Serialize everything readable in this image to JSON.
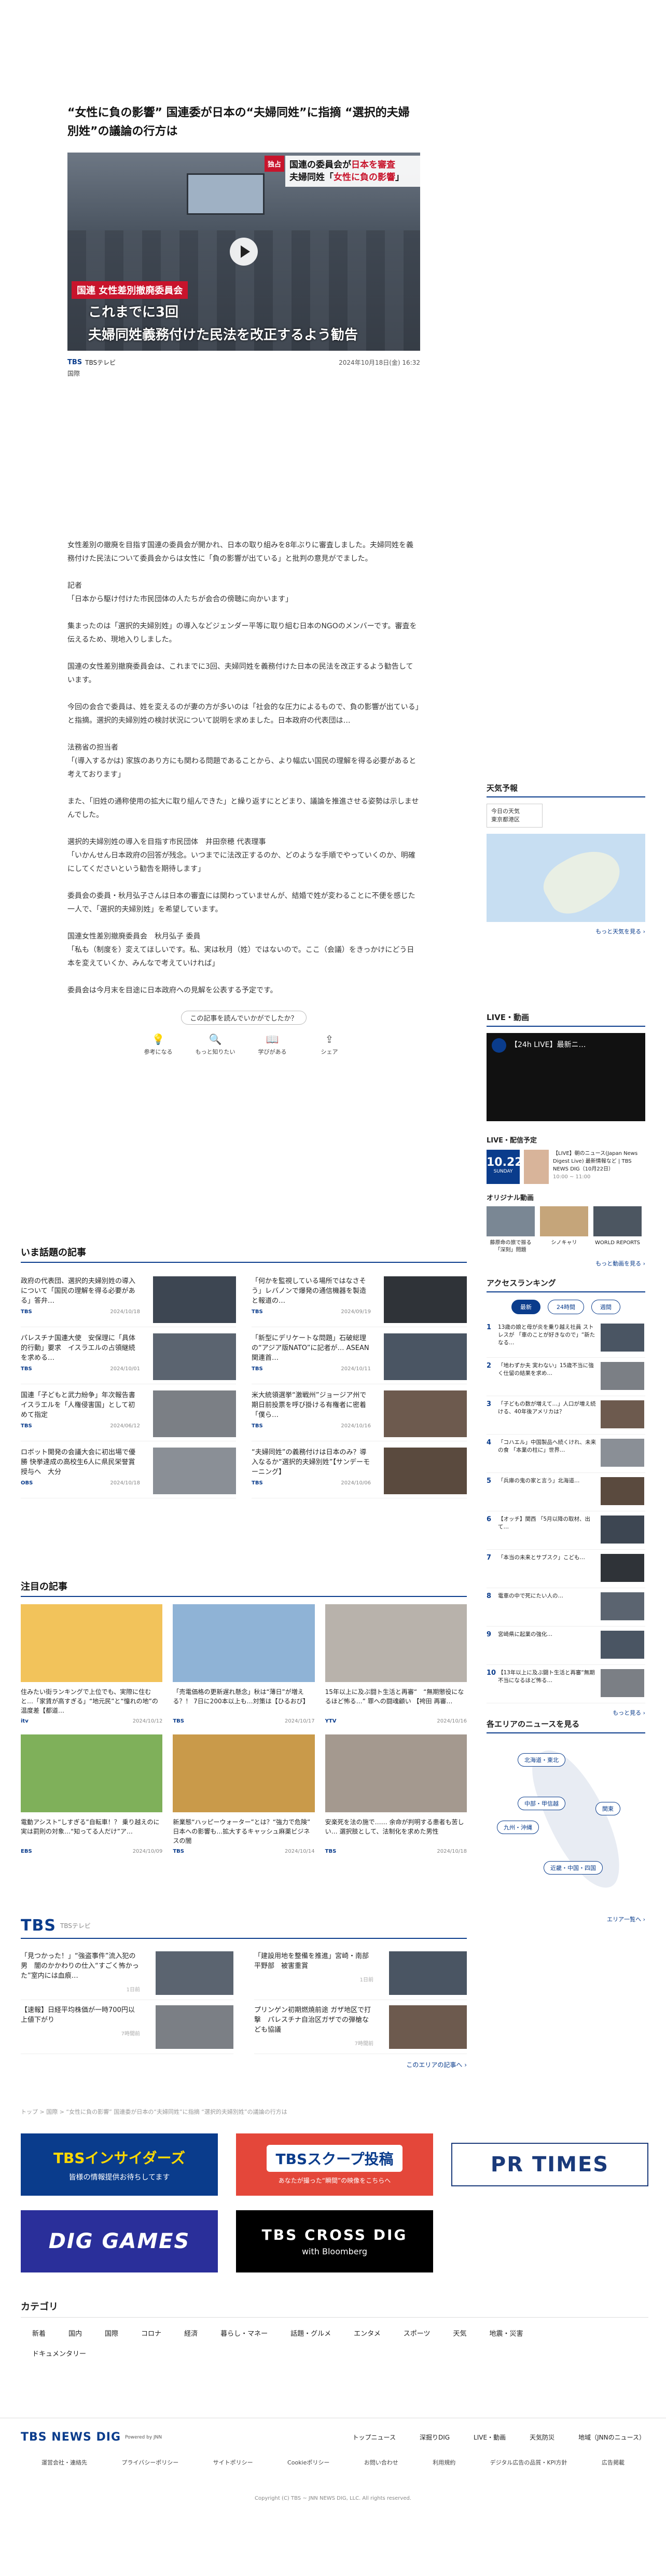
{
  "article": {
    "title": "“女性に負の影響” 国連委が日本の“夫婦同姓”に指摘 “選択的夫婦別姓”の議論の行方は",
    "video_caption": {
      "tag": "独占",
      "top_line1": "国連の委員会が",
      "top_highlight1": "日本を審査",
      "top_line2": "夫婦同姓「",
      "top_highlight2": "女性に負の影響",
      "top_line2_end": "」",
      "committee": "国連 女性差別撤廃委員会",
      "main1": "これまでに3回",
      "main2": "夫婦同姓義務付けた民法を改正するよう勧告"
    },
    "source": "TBSテレビ",
    "date": "2024年10月18日(金) 16:32",
    "category": "国際",
    "paragraphs": [
      "女性差別の撤廃を目指す国連の委員会が開かれ、日本の取り組みを8年ぶりに審査しました。夫婦同姓を義務付けた民法について委員会からは女性に「負の影響が出ている」と批判の意見がでました。",
      "記者\n「日本から駆け付けた市民団体の人たちが会合の傍聴に向かいます」",
      "集まったのは「選択的夫婦別姓」の導入などジェンダー平等に取り組む日本のNGOのメンバーです。審査を伝えるため、現地入りしました。",
      "国連の女性差別撤廃委員会は、これまでに3回、夫婦同姓を義務付けた日本の民法を改正するよう勧告しています。",
      "今回の会合で委員は、姓を変えるのが妻の方が多いのは「社会的な圧力によるもので、負の影響が出ている」と指摘。選択的夫婦別姓の検討状況について説明を求めました。日本政府の代表団は…",
      "法務省の担当者\n「(導入するかは) 家族のあり方にも関わる問題であることから、より幅広い国民の理解を得る必要があると考えております」",
      "また、「旧姓の通称使用の拡大に取り組んできた」と繰り返すにとどまり、議論を推進させる姿勢は示しませんでした。",
      "選択的夫婦別姓の導入を目指す市民団体　井田奈穂 代表理事\n「いかんせん日本政府の回答が残念。いつまでに法改正するのか、どのような手順でやっていくのか、明確にしてくださいという勧告を期待します」",
      "委員会の委員・秋月弘子さんは日本の審査には関わっていませんが、結婚で姓が変わることに不便を感じた一人で、「選択的夫婦別姓」を希望しています。",
      "国連女性差別撤廃委員会　秋月弘子 委員\n「私も（制度を）変えてほしいです。私、実は秋月（姓）ではないので。ここ（会議）をきっかけにどう日本を変えていくか、みんなで考えていければ」",
      "委員会は今月末を目途に日本政府への見解を公表する予定です。"
    ]
  },
  "reactions": {
    "question": "この記事を読んでいかがでしたか？",
    "items": [
      {
        "icon": "lightbulb-icon",
        "glyph": "💡",
        "label": "参考になる"
      },
      {
        "icon": "magnifier-icon",
        "glyph": "🔍",
        "label": "もっと知りたい"
      },
      {
        "icon": "book-icon",
        "glyph": "📖",
        "label": "学びがある"
      },
      {
        "icon": "share-icon",
        "glyph": "⇪",
        "label": "シェア"
      }
    ]
  },
  "popular": {
    "title": "いま話題の記事",
    "items": [
      {
        "title": "政府の代表団、選択的夫婦別姓の導入について「国民の理解を得る必要がある」答弁…",
        "source": "TBS",
        "date": "2024/10/18"
      },
      {
        "title": "「何かを監視している場所ではなさそう」レバノンで爆発の通信機器を製造と報道の…",
        "source": "TBS",
        "date": "2024/09/19"
      },
      {
        "title": "パレスチナ国連大使　安保理に「具体的行動」要求　イスラエルの占領継続を求める…",
        "source": "TBS",
        "date": "2024/10/01"
      },
      {
        "title": "「新型にデリケートな問題」石破総理の“アジア版NATO”に記者が… ASEAN関連首…",
        "source": "TBS",
        "date": "2024/10/11"
      },
      {
        "title": "国連「子どもと武力紛争」年次報告書　イスラエルを「人権侵害国」として初めて指定",
        "source": "TBS",
        "date": "2024/06/12"
      },
      {
        "title": "米大統領選挙“激戦州”ジョージア州で期日前投票を呼び掛ける有権者に密着「僕ら…",
        "source": "TBS",
        "date": "2024/10/16"
      },
      {
        "title": "ロボット開発の会議大会に初出場で優勝 快挙達成の高校生6人に県民栄誉賞授与へ　大分",
        "source": "OBS",
        "date": "2024/10/18"
      },
      {
        "title": "“夫婦同姓”の義務付けは日本のみ？導入なるか“選択的夫婦別姓”【サンデーモーニング】",
        "source": "TBS",
        "date": "2024/10/06"
      }
    ]
  },
  "attention": {
    "title": "注目の記事",
    "items": [
      {
        "title": "住みたい街ランキングで上位でも、実際に住むと…「家賃が高すぎる」“地元民”と“憧れの地”の温度差【都道…",
        "source": "itv",
        "date": "2024/10/12",
        "img": "ranking-banner"
      },
      {
        "title": "「売電価格の更新遅れ懸念」秋は“薄日”が増える？！ 7日に200本以上も…対策は【ひるおび】",
        "source": "TBS",
        "date": "2024/10/17",
        "img": "weather-studio"
      },
      {
        "title": "15年以上に及ぶ闘ト生活と再審“　“無期懲役になるほど怖る…” 罪への闘魂顧い 【袴田 再審…",
        "source": "YTV",
        "date": "2024/10/16",
        "img": "older-woman"
      },
      {
        "title": "電動アシスト“しすぎる”自転車！？ 乗り越えのに実は罰則の対象…“知ってる人だけ”ア…",
        "source": "EBS",
        "date": "2024/10/09",
        "img": "bike-banner"
      },
      {
        "title": "新業態“ハッピーウォーター”とは？“強力で危険” 日本への影響も…拡大するキャッシュ麻薬ビジネスの闇",
        "source": "TBS",
        "date": "2024/10/14",
        "img": "mahjong-business"
      },
      {
        "title": "安楽死を法の施で…… 余命が判明する患者も苦しい… 選択肢として、法制化を求めた男性",
        "source": "TBS",
        "date": "2024/10/18",
        "img": "man-portrait"
      }
    ]
  },
  "tbs": {
    "logo": "TBS",
    "sub": "TBSテレビ",
    "items": [
      {
        "title": "「見つかった！」“強盗事件”流入犯の男　闇のかかわりの仕入“すごく怖かった”室内には血痕…",
        "date": "1日前"
      },
      {
        "title": "「建設用地を整備を推進」宮崎・南部平野部　被害重賞",
        "date": "1日前"
      },
      {
        "title": "【速報】日経平均株価が一時700円以上値下がり",
        "date": "7時間前"
      },
      {
        "title": "プリンゲン初期燃焼前途 ガザ地区で打撃　パレスチナ自治区ガザでの弾槍なども協議",
        "date": "7時間前"
      }
    ],
    "more": "このエリアの記事へ ›"
  },
  "breadcrumb": "トップ > 国際 > “女性に負の影響” 国連委が日本の“夫婦同姓”に指摘 “選択的夫婦別姓”の議論の行方は",
  "banners": {
    "insiders": "TBSインサイダーズ",
    "insiders_sub": "皆様の情報提供お待ちしてます",
    "scoop": "TBSスクープ投稿",
    "scoop_sub": "あなたが撮った“瞬間”の映像をこちらへ",
    "prtimes": "PR TIMES",
    "diggames": "DIG GAMES",
    "crossdig": "TBS CROSS DIG",
    "crossdig_sub": "with Bloomberg"
  },
  "categories": {
    "title": "カテゴリ",
    "items": [
      "新着",
      "国内",
      "国際",
      "コロナ",
      "経済",
      "暮らし・マネー",
      "話題・グルメ",
      "エンタメ",
      "スポーツ",
      "天気",
      "地震・災害",
      "ドキュメンタリー"
    ]
  },
  "footer": {
    "logo": "TBS NEWS DIG",
    "logo_sub": "Powered by JNN",
    "nav": [
      "トップニュース",
      "深掘りDIG",
      "LIVE・動画",
      "天気防災",
      "地域（JNNのニュース）"
    ],
    "links": [
      "運営会社・連絡先",
      "プライバシーポリシー",
      "サイトポリシー",
      "Cookieポリシー",
      "お問い合わせ",
      "利用規約",
      "デジタル広告の品質・KPI方針",
      "広告掲載"
    ],
    "copyright": "Copyright (C) TBS ~ JNN NEWS DIG, LLC. All rights reserved."
  },
  "sidebar": {
    "weather": {
      "title": "天気予報",
      "location_label": "今日の天気",
      "location": "東京都港区",
      "more": "もっと天気を見る ›"
    },
    "live": {
      "title": "LIVE・動画",
      "player_title": "【24h LIVE】最新ニ…",
      "schedule_title": "LIVE・配信予定",
      "schedule_badge": "LIVE",
      "schedule_date": "2024/10/22",
      "schedule_day": "10.22",
      "schedule_day_sub": "SUNDAY",
      "schedule_text": "【LIVE】朝のニュース(Japan News Digest Live) 最新情報など | TBS NEWS DIG（10月22日）",
      "schedule_time": "10:00 ~ 11:00",
      "original_title": "オリジナル動画",
      "original": [
        "藤原命の旅で振る「深刻」問題",
        "シノキャリ",
        "WORLD REPORTS"
      ],
      "more": "もっと動画を見る ›"
    },
    "ranking": {
      "title": "アクセスランキング",
      "tabs": [
        "最新",
        "24時間",
        "週間"
      ],
      "items": [
        "13歳の娘と母が炎を乗り越え社員 ストレスが 「車のことが好きなので」“新たなる…",
        "「地わずか夫 実わない」15歳不当に強く仕留の結果を求め…",
        "「子どもの数が増えて…」人口が増え続ける、40年後アメリカは？",
        "「コハエル」中国製品へ続くけれ、未来の食 「本業の柱に」世界…",
        "「兵庫の鬼の家と言う」北海道…",
        "【オッチ】関西 「5月以降の取材、出て…",
        "「本当の未来とサブスク」こども…",
        "電車の中で死にたい人の…",
        "宮崎県に起業の強化…",
        "【13年以上に及ぶ闘ト生活と再審“無期不当になるほど怖る…"
      ],
      "more": "もっと見る ›"
    },
    "area": {
      "title": "各エリアのニュースを見る",
      "areas": [
        "北海道・東北",
        "関東",
        "中部・甲信越",
        "九州・沖縄",
        "近畿・中国・四国"
      ],
      "more": "エリア一覧へ ›"
    }
  }
}
